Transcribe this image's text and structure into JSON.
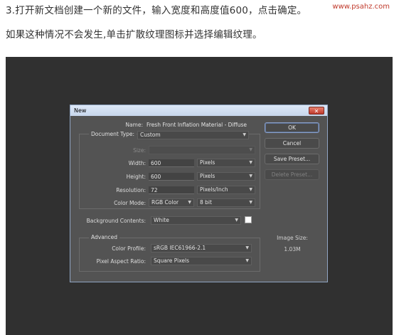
{
  "caption": {
    "line1": "3.打开新文档创建一个新的文件，输入宽度和高度值600，点击确定。",
    "line2": "如果这种情况不会发生,单击扩散纹理图标并选择编辑纹理。",
    "watermark": "www.psahz.com"
  },
  "dialog": {
    "title": "New",
    "close_glyph": "✕",
    "name_label": "Name:",
    "name_value": "Fresh Front Inflation Material - Diffuse",
    "preset_label": "Document Type:",
    "preset_value": "Custom",
    "size_label": "Size:",
    "size_value": "",
    "width_label": "Width:",
    "width_value": "600",
    "width_unit": "Pixels",
    "height_label": "Height:",
    "height_value": "600",
    "height_unit": "Pixels",
    "resolution_label": "Resolution:",
    "resolution_value": "72",
    "resolution_unit": "Pixels/Inch",
    "color_mode_label": "Color Mode:",
    "color_mode_value": "RGB Color",
    "bit_depth_value": "8 bit",
    "background_label": "Background Contents:",
    "background_value": "White",
    "background_swatch_color": "#ffffff",
    "advanced_legend": "Advanced",
    "color_profile_label": "Color Profile:",
    "color_profile_value": "sRGB IEC61966-2.1",
    "pixel_aspect_label": "Pixel Aspect Ratio:",
    "pixel_aspect_value": "Square Pixels",
    "buttons": {
      "ok": "OK",
      "cancel": "Cancel",
      "save_preset": "Save Preset...",
      "delete_preset": "Delete Preset..."
    },
    "image_size_label": "Image Size:",
    "image_size_value": "1.03M"
  },
  "icons": {
    "caret": "chevron-down-icon",
    "close": "close-icon"
  }
}
